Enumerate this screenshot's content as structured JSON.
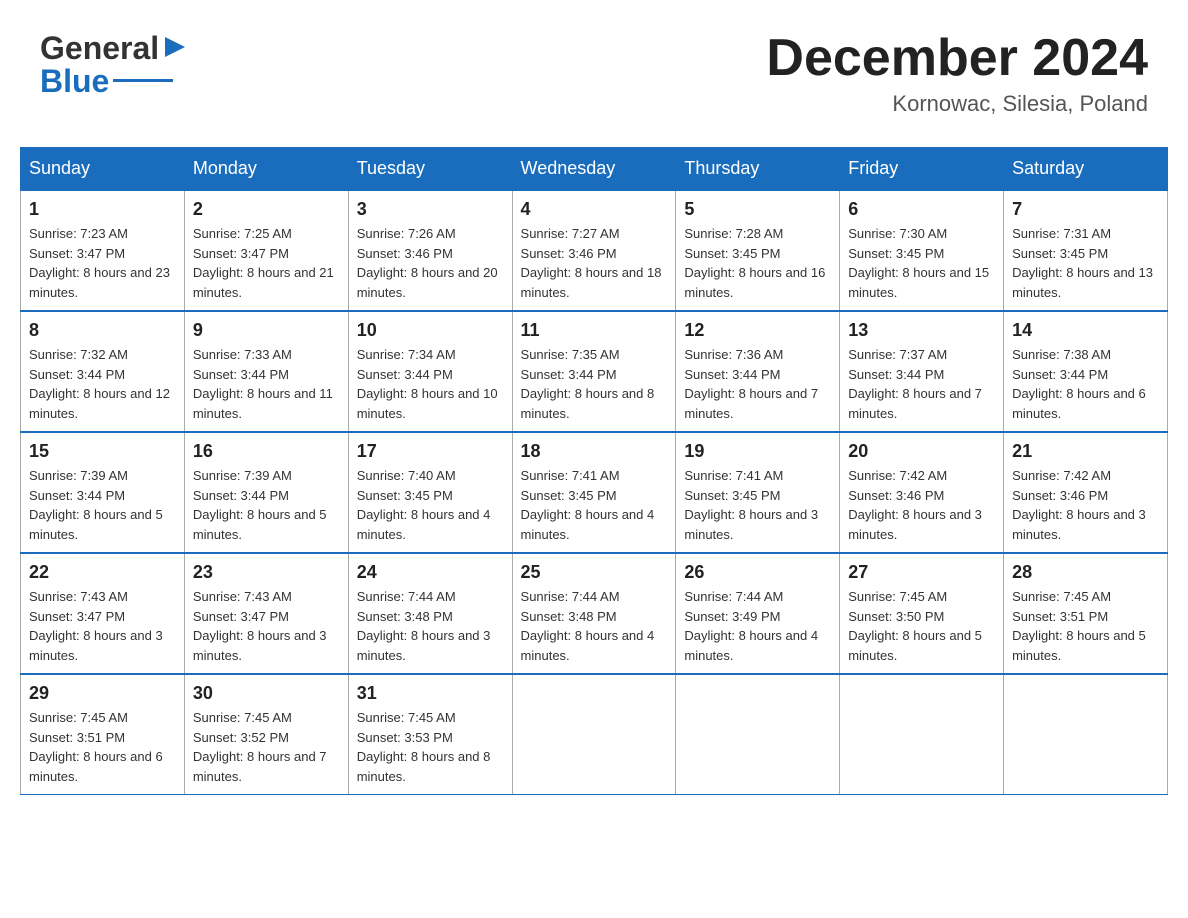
{
  "logo": {
    "text_general": "General",
    "text_blue": "Blue"
  },
  "header": {
    "month_year": "December 2024",
    "location": "Kornowac, Silesia, Poland"
  },
  "days_of_week": [
    "Sunday",
    "Monday",
    "Tuesday",
    "Wednesday",
    "Thursday",
    "Friday",
    "Saturday"
  ],
  "weeks": [
    [
      {
        "day": "1",
        "sunrise": "Sunrise: 7:23 AM",
        "sunset": "Sunset: 3:47 PM",
        "daylight": "Daylight: 8 hours and 23 minutes."
      },
      {
        "day": "2",
        "sunrise": "Sunrise: 7:25 AM",
        "sunset": "Sunset: 3:47 PM",
        "daylight": "Daylight: 8 hours and 21 minutes."
      },
      {
        "day": "3",
        "sunrise": "Sunrise: 7:26 AM",
        "sunset": "Sunset: 3:46 PM",
        "daylight": "Daylight: 8 hours and 20 minutes."
      },
      {
        "day": "4",
        "sunrise": "Sunrise: 7:27 AM",
        "sunset": "Sunset: 3:46 PM",
        "daylight": "Daylight: 8 hours and 18 minutes."
      },
      {
        "day": "5",
        "sunrise": "Sunrise: 7:28 AM",
        "sunset": "Sunset: 3:45 PM",
        "daylight": "Daylight: 8 hours and 16 minutes."
      },
      {
        "day": "6",
        "sunrise": "Sunrise: 7:30 AM",
        "sunset": "Sunset: 3:45 PM",
        "daylight": "Daylight: 8 hours and 15 minutes."
      },
      {
        "day": "7",
        "sunrise": "Sunrise: 7:31 AM",
        "sunset": "Sunset: 3:45 PM",
        "daylight": "Daylight: 8 hours and 13 minutes."
      }
    ],
    [
      {
        "day": "8",
        "sunrise": "Sunrise: 7:32 AM",
        "sunset": "Sunset: 3:44 PM",
        "daylight": "Daylight: 8 hours and 12 minutes."
      },
      {
        "day": "9",
        "sunrise": "Sunrise: 7:33 AM",
        "sunset": "Sunset: 3:44 PM",
        "daylight": "Daylight: 8 hours and 11 minutes."
      },
      {
        "day": "10",
        "sunrise": "Sunrise: 7:34 AM",
        "sunset": "Sunset: 3:44 PM",
        "daylight": "Daylight: 8 hours and 10 minutes."
      },
      {
        "day": "11",
        "sunrise": "Sunrise: 7:35 AM",
        "sunset": "Sunset: 3:44 PM",
        "daylight": "Daylight: 8 hours and 8 minutes."
      },
      {
        "day": "12",
        "sunrise": "Sunrise: 7:36 AM",
        "sunset": "Sunset: 3:44 PM",
        "daylight": "Daylight: 8 hours and 7 minutes."
      },
      {
        "day": "13",
        "sunrise": "Sunrise: 7:37 AM",
        "sunset": "Sunset: 3:44 PM",
        "daylight": "Daylight: 8 hours and 7 minutes."
      },
      {
        "day": "14",
        "sunrise": "Sunrise: 7:38 AM",
        "sunset": "Sunset: 3:44 PM",
        "daylight": "Daylight: 8 hours and 6 minutes."
      }
    ],
    [
      {
        "day": "15",
        "sunrise": "Sunrise: 7:39 AM",
        "sunset": "Sunset: 3:44 PM",
        "daylight": "Daylight: 8 hours and 5 minutes."
      },
      {
        "day": "16",
        "sunrise": "Sunrise: 7:39 AM",
        "sunset": "Sunset: 3:44 PM",
        "daylight": "Daylight: 8 hours and 5 minutes."
      },
      {
        "day": "17",
        "sunrise": "Sunrise: 7:40 AM",
        "sunset": "Sunset: 3:45 PM",
        "daylight": "Daylight: 8 hours and 4 minutes."
      },
      {
        "day": "18",
        "sunrise": "Sunrise: 7:41 AM",
        "sunset": "Sunset: 3:45 PM",
        "daylight": "Daylight: 8 hours and 4 minutes."
      },
      {
        "day": "19",
        "sunrise": "Sunrise: 7:41 AM",
        "sunset": "Sunset: 3:45 PM",
        "daylight": "Daylight: 8 hours and 3 minutes."
      },
      {
        "day": "20",
        "sunrise": "Sunrise: 7:42 AM",
        "sunset": "Sunset: 3:46 PM",
        "daylight": "Daylight: 8 hours and 3 minutes."
      },
      {
        "day": "21",
        "sunrise": "Sunrise: 7:42 AM",
        "sunset": "Sunset: 3:46 PM",
        "daylight": "Daylight: 8 hours and 3 minutes."
      }
    ],
    [
      {
        "day": "22",
        "sunrise": "Sunrise: 7:43 AM",
        "sunset": "Sunset: 3:47 PM",
        "daylight": "Daylight: 8 hours and 3 minutes."
      },
      {
        "day": "23",
        "sunrise": "Sunrise: 7:43 AM",
        "sunset": "Sunset: 3:47 PM",
        "daylight": "Daylight: 8 hours and 3 minutes."
      },
      {
        "day": "24",
        "sunrise": "Sunrise: 7:44 AM",
        "sunset": "Sunset: 3:48 PM",
        "daylight": "Daylight: 8 hours and 3 minutes."
      },
      {
        "day": "25",
        "sunrise": "Sunrise: 7:44 AM",
        "sunset": "Sunset: 3:48 PM",
        "daylight": "Daylight: 8 hours and 4 minutes."
      },
      {
        "day": "26",
        "sunrise": "Sunrise: 7:44 AM",
        "sunset": "Sunset: 3:49 PM",
        "daylight": "Daylight: 8 hours and 4 minutes."
      },
      {
        "day": "27",
        "sunrise": "Sunrise: 7:45 AM",
        "sunset": "Sunset: 3:50 PM",
        "daylight": "Daylight: 8 hours and 5 minutes."
      },
      {
        "day": "28",
        "sunrise": "Sunrise: 7:45 AM",
        "sunset": "Sunset: 3:51 PM",
        "daylight": "Daylight: 8 hours and 5 minutes."
      }
    ],
    [
      {
        "day": "29",
        "sunrise": "Sunrise: 7:45 AM",
        "sunset": "Sunset: 3:51 PM",
        "daylight": "Daylight: 8 hours and 6 minutes."
      },
      {
        "day": "30",
        "sunrise": "Sunrise: 7:45 AM",
        "sunset": "Sunset: 3:52 PM",
        "daylight": "Daylight: 8 hours and 7 minutes."
      },
      {
        "day": "31",
        "sunrise": "Sunrise: 7:45 AM",
        "sunset": "Sunset: 3:53 PM",
        "daylight": "Daylight: 8 hours and 8 minutes."
      },
      null,
      null,
      null,
      null
    ]
  ]
}
